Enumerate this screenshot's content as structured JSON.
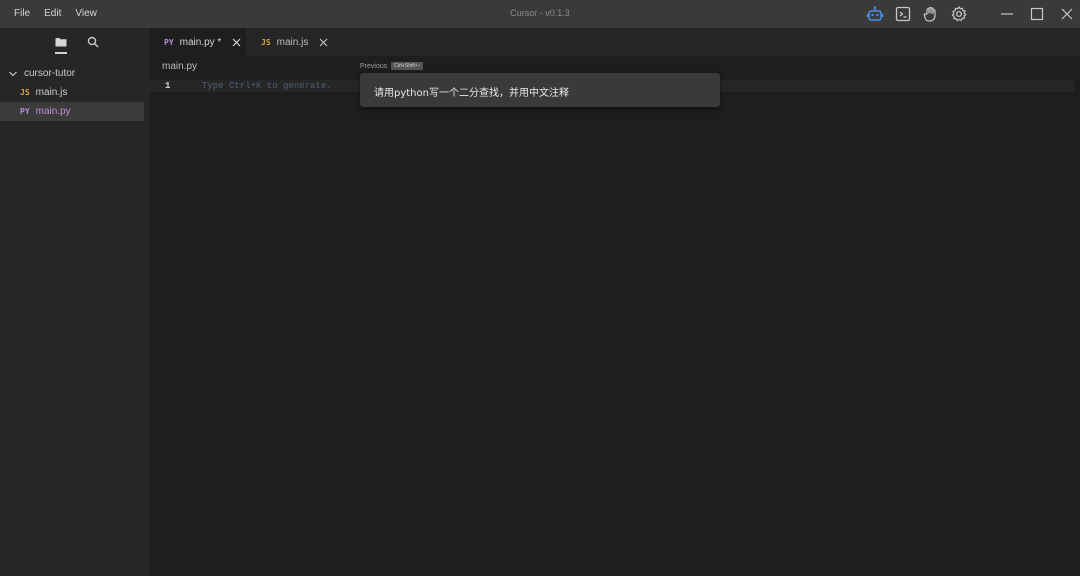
{
  "menu": [
    "File",
    "Edit",
    "View"
  ],
  "window_title": "Cursor - v0.1.3",
  "toolbar_icons": [
    "robot-icon",
    "terminal-icon",
    "hand-icon",
    "gear-icon"
  ],
  "window_controls": [
    "minimize-icon",
    "maximize-icon",
    "close-icon"
  ],
  "sidebar": {
    "folder": "cursor-tutor",
    "files": [
      {
        "badge": "JS",
        "name": "main.js",
        "active": false
      },
      {
        "badge": "PY",
        "name": "main.py",
        "active": true
      }
    ]
  },
  "tabs": [
    {
      "badge": "PY",
      "label": "main.py *",
      "active": true
    },
    {
      "badge": "JS",
      "label": "main.js",
      "active": false
    }
  ],
  "editor": {
    "breadcrumb": "main.py",
    "previous_label": "Previous",
    "previous_shortcut": "Ctrl+Shift+↑",
    "line_number": "1",
    "placeholder": "Type Ctrl+K to generate."
  },
  "prompt": {
    "text": "请用python写一个二分查找，并用中文注释"
  },
  "colors": {
    "accent_blue": "#4a90e2",
    "py_badge": "#b58fd6",
    "js_badge": "#d6a541"
  }
}
